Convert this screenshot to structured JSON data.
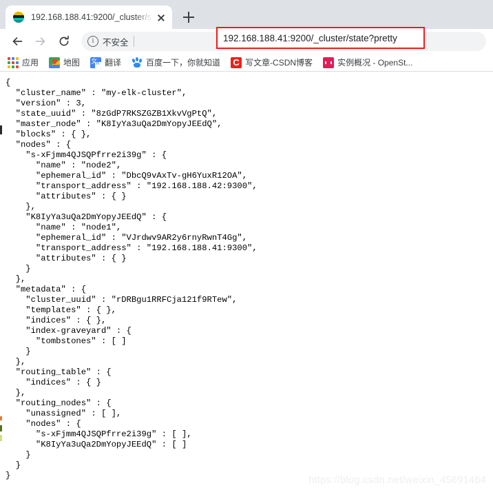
{
  "browser": {
    "tab": {
      "title": "192.168.188.41:9200/_cluster/s",
      "favicon": "elasticsearch-icon",
      "close_icon": "close-icon"
    },
    "new_tab_label": "+",
    "nav": {
      "back_icon": "back-arrow-icon",
      "forward_icon": "forward-arrow-icon",
      "reload_icon": "reload-icon"
    },
    "omnibox": {
      "security_icon": "info-circle-icon",
      "security_label": "不安全",
      "url": "192.168.188.41:9200/_cluster/state?pretty",
      "highlight_color": "#ee1c18"
    },
    "bookmarks": [
      {
        "icon": "apps-grid-icon",
        "label": "应用"
      },
      {
        "icon": "maps-pin-icon",
        "label": "地图"
      },
      {
        "icon": "translate-icon",
        "label": "翻译"
      },
      {
        "icon": "baidu-paw-icon",
        "label": "百度一下，你就知道"
      },
      {
        "icon": "csdn-icon",
        "label": "写文章-CSDN博客"
      },
      {
        "icon": "openstack-icon",
        "label": "实例概况 - OpenSt..."
      }
    ]
  },
  "page": {
    "watermark": "https://blog.csdn.net/weixin_45691464",
    "response_text": "{\n  \"cluster_name\" : \"my-elk-cluster\",\n  \"version\" : 3,\n  \"state_uuid\" : \"8zGdP7RKSZGZB1XkvVgPtQ\",\n  \"master_node\" : \"K8IyYa3uQa2DmYopyJEEdQ\",\n  \"blocks\" : { },\n  \"nodes\" : {\n    \"s-xFjmm4QJSQPfrre2i39g\" : {\n      \"name\" : \"node2\",\n      \"ephemeral_id\" : \"DbcQ9vAxTv-gH6YuxR12OA\",\n      \"transport_address\" : \"192.168.188.42:9300\",\n      \"attributes\" : { }\n    },\n    \"K8IyYa3uQa2DmYopyJEEdQ\" : {\n      \"name\" : \"node1\",\n      \"ephemeral_id\" : \"VJrdwv9AR2y6rnyRwnT4Gg\",\n      \"transport_address\" : \"192.168.188.41:9300\",\n      \"attributes\" : { }\n    }\n  },\n  \"metadata\" : {\n    \"cluster_uuid\" : \"rDRBgu1RRFCja121f9RTew\",\n    \"templates\" : { },\n    \"indices\" : { },\n    \"index-graveyard\" : {\n      \"tombstones\" : [ ]\n    }\n  },\n  \"routing_table\" : {\n    \"indices\" : { }\n  },\n  \"routing_nodes\" : {\n    \"unassigned\" : [ ],\n    \"nodes\" : {\n      \"s-xFjmm4QJSQPfrre2i39g\" : [ ],\n      \"K8IyYa3uQa2DmYopyJEEdQ\" : [ ]\n    }\n  }\n}"
  }
}
